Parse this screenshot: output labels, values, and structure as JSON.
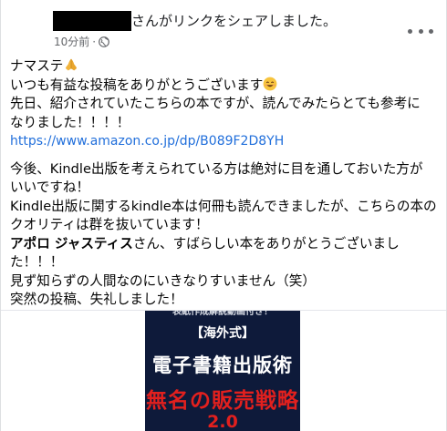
{
  "header": {
    "share_text": "さんがリンクをシェアしました。",
    "timestamp": "10分前",
    "separator": "·",
    "privacy_icon": "globe-icon",
    "more_icon": "more-options-icon"
  },
  "post": {
    "greeting": "ナマステ",
    "greeting_emoji": "folded-hands-icon",
    "line1": "いつも有益な投稿をありがとうございます",
    "line1_emoji": "smiling-face-icon",
    "line2": "先日、紹介されていたこちらの本ですが、読んでみたらとても参考に",
    "line3": "なりました！！！！",
    "link": "https://www.amazon.co.jp/dp/B089F2D8YH",
    "para2_line1": "今後、Kindle出版を考えられている方は絶対に目を通しておいた方が",
    "para2_line2": "いいですね！",
    "para2_line3": "Kindle出版に関するkindle本は何冊も読んできましたが、こちらの本の",
    "para2_line4": "クオリティは群を抜いています！",
    "author_name": "アポロ ジャスティス",
    "thanks_line1": "さん、すばらしい本をありがとうございまし",
    "thanks_line2": "た！！！",
    "apology1": "見ず知らずの人間なのにいきなりすいません（笑）",
    "apology2": "突然の投稿、失礼しました！"
  },
  "preview": {
    "cover_top": "表紙作成解説動画付き！",
    "cover_kaigai": "【海外式】",
    "cover_title": "電子書籍出版術",
    "cover_red": "無名の販売戦略",
    "cover_version": "2.0",
    "colors": {
      "cover_bg": "#0e1a3a",
      "cover_accent": "#e2201e"
    }
  },
  "colors": {
    "link": "#216fdb",
    "meta": "#65676b",
    "text": "#050505"
  }
}
